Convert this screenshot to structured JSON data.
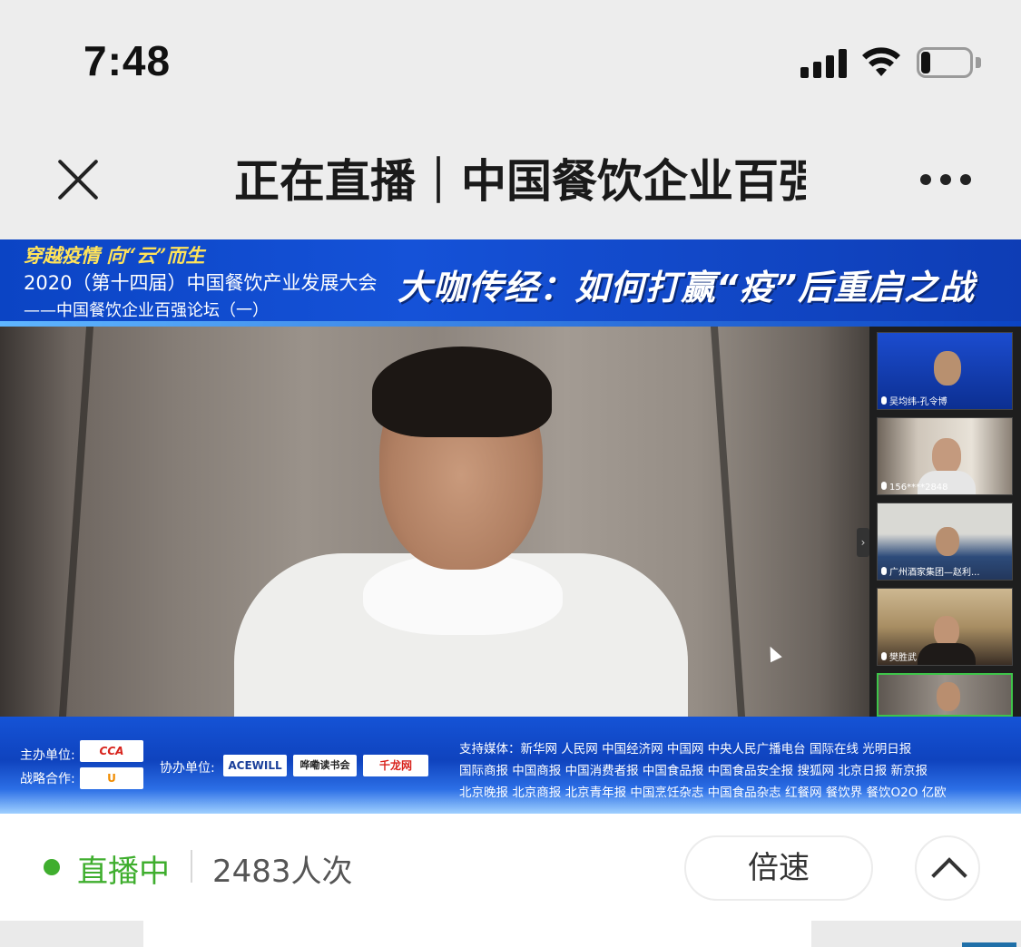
{
  "status_bar": {
    "time": "7:48",
    "signal_icon": "signal-bars-icon",
    "wifi_icon": "wifi-icon",
    "battery_icon": "battery-icon",
    "battery_level": 0.2
  },
  "nav": {
    "close_icon": "close-icon",
    "title": "正在直播｜中国餐饮企业百强",
    "more_icon": "more-dots-icon"
  },
  "video": {
    "banner_top": {
      "slogan": "穿越疫情 向“云”而生",
      "title": "2020（第十四届）中国餐饮产业发展大会",
      "subtitle": "——中国餐饮企业百强论坛（一）",
      "headline": "大咖传经：如何打赢“疫”后重启之战"
    },
    "thumbnails": [
      {
        "label": "吴均纬-孔令博"
      },
      {
        "label": "156****2848"
      },
      {
        "label": "广州酒家集团—赵利..."
      },
      {
        "label": "樊胜武"
      },
      {
        "label": ""
      }
    ],
    "banner_bottom": {
      "host_label": "主办单位:",
      "host_logo": "CCA",
      "strategic_label": "战略合作:",
      "strategic_logo": "U",
      "co_label": "协办单位:",
      "co_logos": [
        "ACEWILL",
        "哗嘞读书会",
        "千龙网"
      ],
      "media_lines": [
        "支持媒体：新华网   人民网   中国经济网   中国网   中央人民广播电台   国际在线   光明日报",
        "国际商报   中国商报   中国消费者报   中国食品报   中国食品安全报   搜狐网   北京日报   新京报",
        "北京晚报   北京商报   北京青年报   中国烹饪杂志   中国食品杂志   红餐网   餐饮界   餐饮O2O   亿欧"
      ]
    }
  },
  "live_bar": {
    "status": "直播中",
    "status_color": "#3fae2e",
    "viewers": "2483人次",
    "speed_button": "倍速",
    "collapse_icon": "chevron-up-icon"
  }
}
